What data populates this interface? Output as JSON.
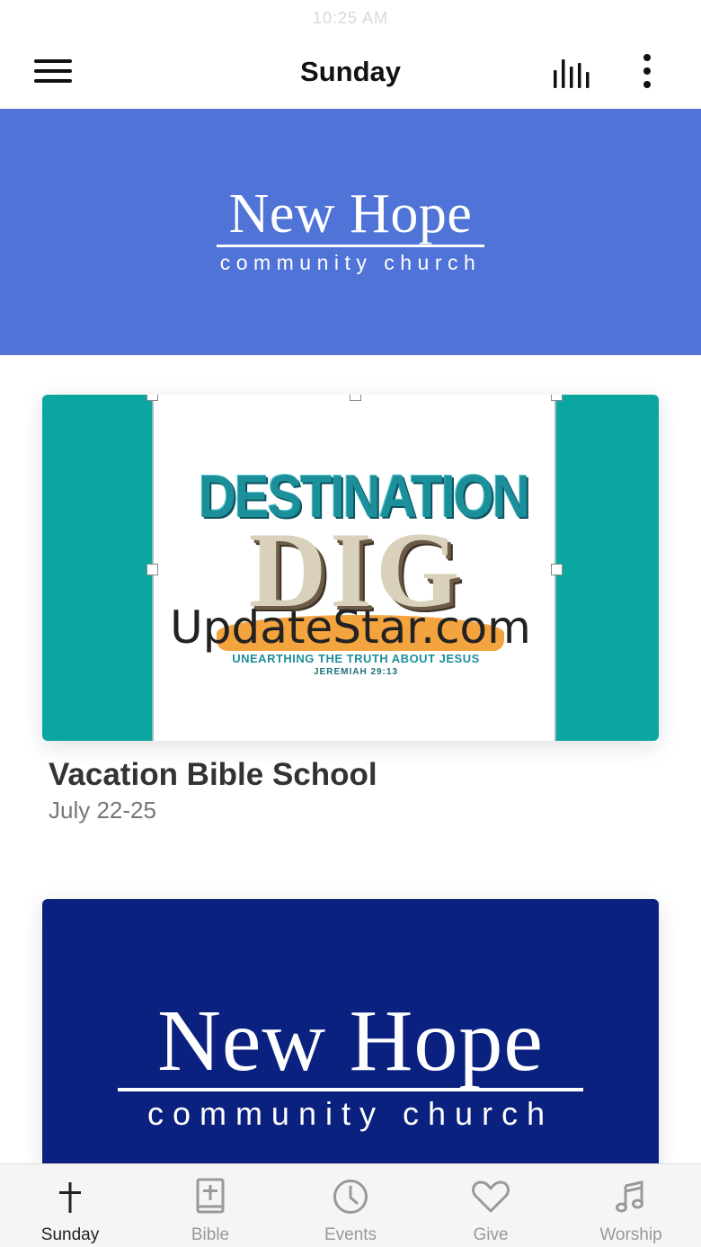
{
  "status_bar": {
    "time": "10:25 AM"
  },
  "header": {
    "title": "Sunday"
  },
  "hero": {
    "logo_main": "New Hope",
    "logo_sub": "community church"
  },
  "feed": [
    {
      "image": {
        "headline": "DESTINATION",
        "headline2": "DIG",
        "tagline": "UNEARTHING THE TRUTH ABOUT JESUS",
        "verse": "JEREMIAH 29:13",
        "watermark": "UpdateStar.com"
      },
      "title": "Vacation Bible School",
      "subtitle": "July 22-25"
    },
    {
      "image": {
        "logo_main": "New Hope",
        "logo_sub": "community church"
      }
    }
  ],
  "tabs": [
    {
      "label": "Sunday",
      "icon": "cross-icon",
      "active": true
    },
    {
      "label": "Bible",
      "icon": "bible-icon",
      "active": false
    },
    {
      "label": "Events",
      "icon": "clock-icon",
      "active": false
    },
    {
      "label": "Give",
      "icon": "heart-icon",
      "active": false
    },
    {
      "label": "Worship",
      "icon": "music-note-icon",
      "active": false
    }
  ],
  "colors": {
    "hero_background": "#4f73d6",
    "vbs_background": "#0aa69f",
    "logo_card_background": "#0b2180",
    "tab_active": "#222222",
    "tab_inactive": "#999999"
  }
}
